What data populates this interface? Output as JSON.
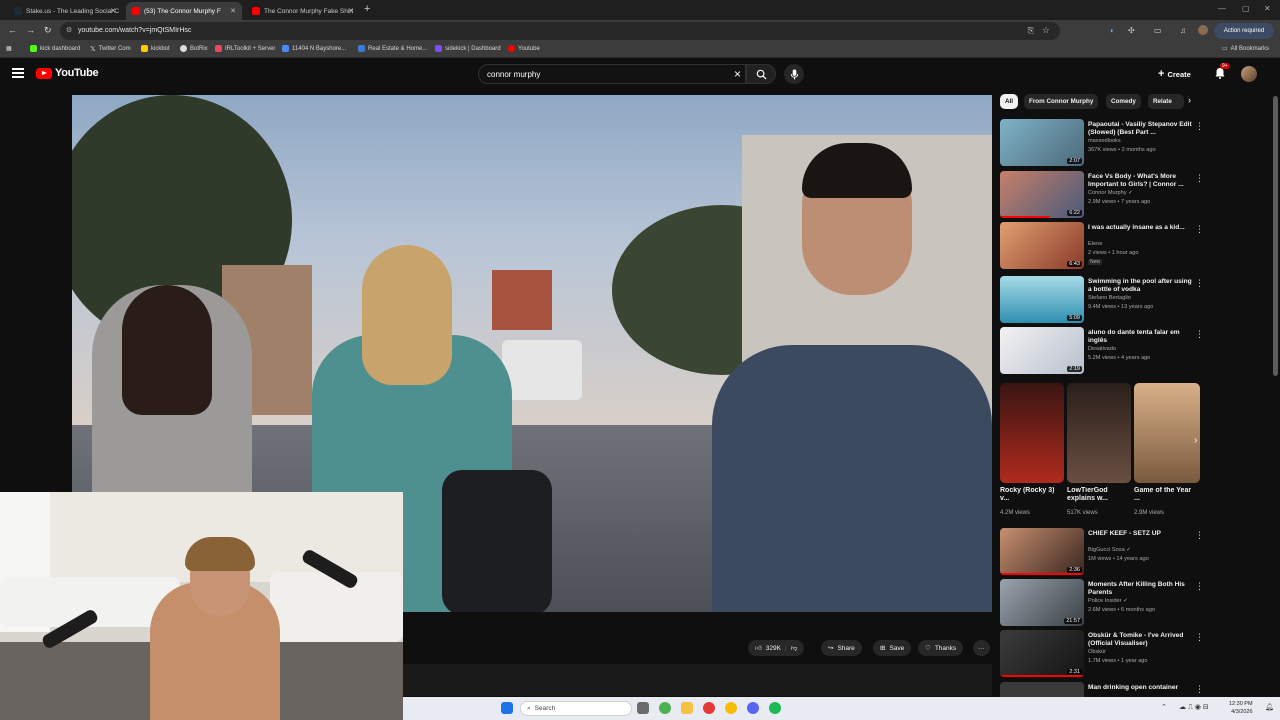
{
  "browser": {
    "tabs": [
      {
        "label": "Stake.us - The Leading Social C",
        "active": false
      },
      {
        "label": "(53) The Connor Murphy F",
        "active": true
      },
      {
        "label": "The Connor Murphy Fake Shirt",
        "active": false
      }
    ],
    "url": "youtube.com/watch?v=jmQtSMIrHsc",
    "action_required": "Action required",
    "bookmarks": [
      {
        "label": "kick dashboard",
        "icon": "kick-icon"
      },
      {
        "label": "Twitter Com",
        "icon": "x-icon"
      },
      {
        "label": "kickbot",
        "icon": "kick-icon"
      },
      {
        "label": "BotRix",
        "icon": "botrix-icon"
      },
      {
        "label": "IRLToolkit + Server",
        "icon": "toolkit-icon"
      },
      {
        "label": "11404 N Bayshore...",
        "icon": "globe-icon"
      },
      {
        "label": "Real Estate & Home...",
        "icon": "house-icon"
      },
      {
        "label": "sidekick | Dashboard",
        "icon": "sidekick-icon"
      },
      {
        "label": "Youtube",
        "icon": "youtube-icon"
      }
    ],
    "all_bookmarks": "All Bookmarks"
  },
  "youtube": {
    "logo": "YouTube",
    "search_query": "connor murphy",
    "create_label": "Create",
    "notif_count": "9+",
    "accent": "#ff0000"
  },
  "video_actions": {
    "likes": "329K",
    "share": "Share",
    "save": "Save",
    "thanks": "Thanks"
  },
  "chips": [
    "All",
    "From Connor Murphy",
    "Comedy",
    "Relate"
  ],
  "related": [
    {
      "title": "Papaoutai - Vasiliy Stepanov Edit (Slowed) (Best Part ...",
      "channel": "maxxedlooks",
      "meta": "367K views • 2 months ago",
      "duration": "2:07",
      "thumb": "#6b8fa3"
    },
    {
      "title": "Face Vs Body - What's More Important to Girls? | Connor ...",
      "channel": "Connor Murphy",
      "meta": "2.9M views • 7 years ago",
      "duration": "6:22",
      "thumb": "#7a5d6a",
      "verified": true
    },
    {
      "title": "I was actually insane as a kid...",
      "channel": "Elene",
      "meta": "2 views • 1 hour ago",
      "duration": "6:43",
      "thumb": "#c96f4a",
      "new": "New"
    },
    {
      "title": "Swimming in the pool after using a bottle of vodka",
      "channel": "Stefano Bertaglio",
      "meta": "9.4M views • 13 years ago",
      "duration": "5:09",
      "thumb": "#3d9bb8"
    },
    {
      "title": "aluno do dante tenta falar em inglês",
      "channel": "Desativado",
      "meta": "5.2M views • 4 years ago",
      "duration": "2:19",
      "thumb": "#cfd4dc"
    }
  ],
  "shorts": [
    {
      "title": "Rocky (Rocky 3) v...",
      "views": "4.2M views",
      "thumb": "#8a2a22"
    },
    {
      "title": "LowTierGod explains w...",
      "views": "517K views",
      "thumb": "#4b3a33"
    },
    {
      "title": "Game of the Year ...",
      "views": "2.9M views",
      "thumb": "#c49a6c"
    }
  ],
  "related2": [
    {
      "title": "CHIEF KEEF - SETZ UP",
      "channel": "BigGucci Sosa",
      "meta": "1M views • 14 years ago",
      "duration": "2:36",
      "thumb": "#7a4a3a",
      "verified": true
    },
    {
      "title": "Moments After Killing Both His Parents",
      "channel": "Police Insider",
      "meta": "2.6M views • 6 months ago",
      "duration": "21:57",
      "thumb": "#5a6068",
      "verified": true
    },
    {
      "title": "Obskür & Tomike - I've Arrived (Official Visualiser)",
      "channel": "Obskür",
      "meta": "1.7M views • 1 year ago",
      "duration": "2:31",
      "thumb": "#2a2a2a"
    },
    {
      "title": "Man drinking open container",
      "channel": "",
      "meta": "",
      "duration": "",
      "thumb": "#444"
    }
  ],
  "taskbar": {
    "search": "Search",
    "time": "12:30 PM",
    "date": "4/3/2026"
  }
}
